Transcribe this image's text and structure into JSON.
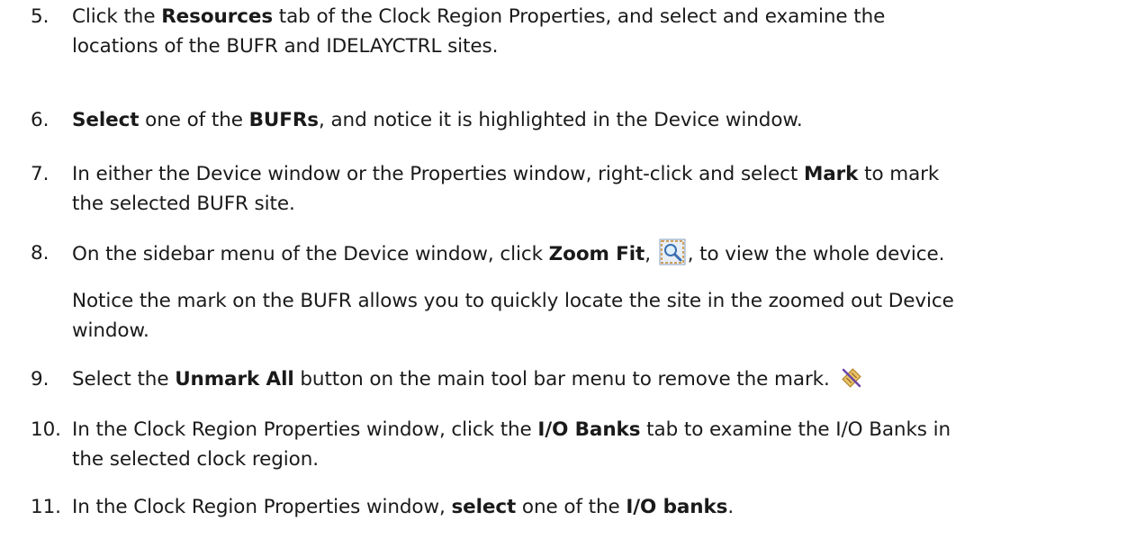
{
  "steps": [
    {
      "number": "5.",
      "parts": [
        "Click the ",
        "Resources",
        " tab of the Clock Region Properties, and select and examine the"
      ],
      "line2": "locations of the BUFR and IDELAYCTRL sites."
    },
    {
      "number": "6.",
      "parts": [
        "Select",
        " one of the ",
        "BUFRs",
        ", and notice it is highlighted in the Device window."
      ]
    },
    {
      "number": "7.",
      "parts": [
        "In either the Device window or the Properties window, right-click and select ",
        "Mark",
        " to mark"
      ],
      "line2": "the selected BUFR site."
    },
    {
      "number": "8.",
      "parts": [
        "On the sidebar menu of the Device window, click ",
        "Zoom Fit",
        ", ",
        ", to view the whole device."
      ],
      "icon": "zoom-fit-icon"
    },
    {
      "number": "9.",
      "parts": [
        "Select the ",
        "Unmark All",
        " button on the main tool bar menu to remove the mark."
      ],
      "icon": "unmark-all-icon"
    },
    {
      "number": "10.",
      "parts": [
        "In the Clock Region Properties window, click the ",
        "I/O Banks",
        " tab to examine the I/O Banks in"
      ],
      "line2": "the selected clock region."
    },
    {
      "number": "11.",
      "parts": [
        "In the Clock Region Properties window, ",
        "select",
        " one of the ",
        "I/O banks",
        "."
      ]
    }
  ],
  "note": {
    "line1": "Notice the mark on the BUFR allows you to quickly locate the site in the zoomed out Device",
    "line2": "window."
  },
  "colors": {
    "text": "#1a1a1a",
    "background": "#ffffff"
  }
}
